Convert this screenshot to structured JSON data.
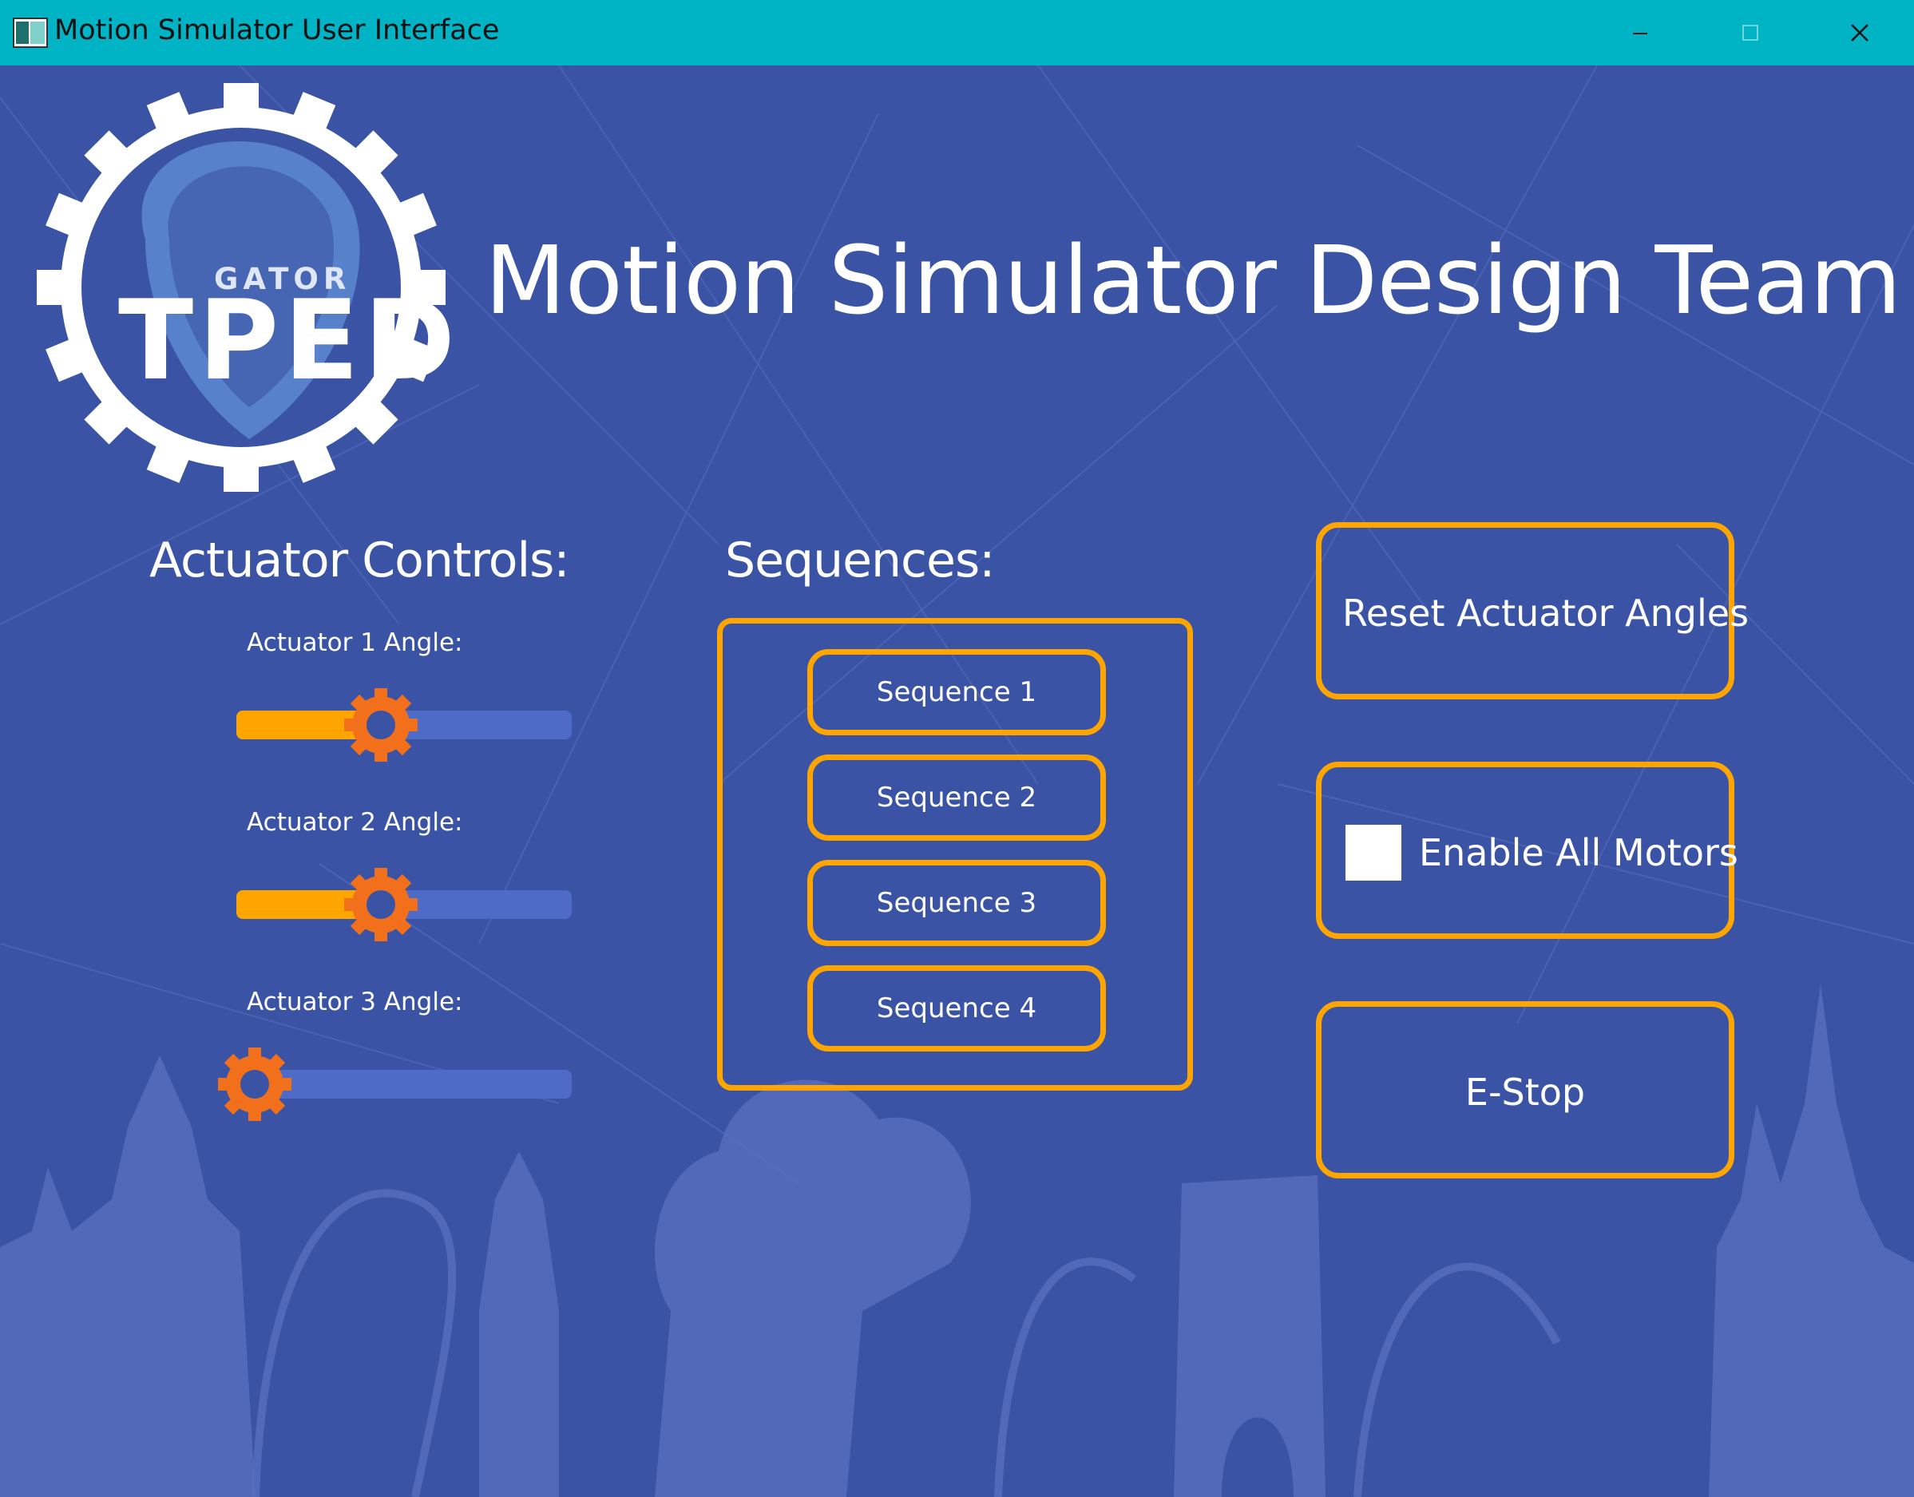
{
  "window": {
    "title": "Motion Simulator User Interface",
    "icon": "app-window-icon",
    "controls": [
      "minimize-icon",
      "maximize-icon",
      "close-icon"
    ]
  },
  "logo": {
    "top_text": "GATOR",
    "main_text": "TPED"
  },
  "header": {
    "title": "Motion Simulator Design Team"
  },
  "actuators": {
    "heading": "Actuator Controls:",
    "sliders": [
      {
        "label": "Actuator 1 Angle:",
        "value_fraction": 0.44
      },
      {
        "label": "Actuator 2 Angle:",
        "value_fraction": 0.44
      },
      {
        "label": "Actuator 3 Angle:",
        "value_fraction": 0.0
      }
    ]
  },
  "sequences": {
    "heading": "Sequences:",
    "buttons": [
      "Sequence 1",
      "Sequence 2",
      "Sequence 3",
      "Sequence 4"
    ]
  },
  "actions": {
    "reset_label": "Reset Actuator Angles",
    "enable_label": "Enable All Motors",
    "enable_checked": false,
    "estop_label": "E-Stop"
  },
  "colors": {
    "background": "#3a53a4",
    "titlebar": "#00b4c5",
    "accent": "#ffa500",
    "slider_handle": "#f26f1b",
    "slider_track": "#4f6bc8",
    "text": "#ffffff"
  }
}
